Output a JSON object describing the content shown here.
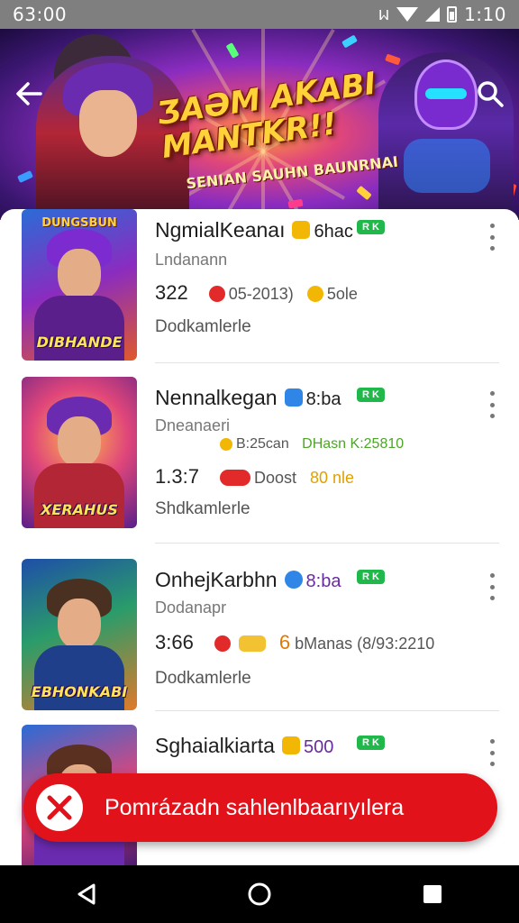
{
  "status_bar": {
    "time": "63:00",
    "right_time": "1:10",
    "right_glyph": "ᥕ"
  },
  "banner": {
    "title_line1": "ƷAƏM AKABI",
    "title_line2": "MANTKR!!",
    "subtitle": "SENIAN SAUHN BAUNRNAI"
  },
  "items": [
    {
      "thumb_top": "DUNGSBUN",
      "thumb_title": "DIBHANDE",
      "title": "NgmialKeanaı",
      "tag": "6hac",
      "tag_color": "#f2b705",
      "badge": "R K",
      "sub": "Lndanann",
      "number": "322",
      "meta1": "05-2013)",
      "meta2": "5ole",
      "foot": "Dodkamlerle"
    },
    {
      "thumb_top": "",
      "thumb_title": "XERAHUS",
      "title": "Nennalkegan",
      "tag": "8:ba",
      "tag_color": "#2f86e6",
      "badge": "R K",
      "sub": "Dneanaeri",
      "extra1": "B:25can",
      "extra2": "DHasn K:25810",
      "number": "1.3:7",
      "meta1": "Doost",
      "meta2": "80 nle",
      "foot": "Shdkamlerle"
    },
    {
      "thumb_top": "",
      "thumb_title": "EBHONKABI",
      "title": "OnhejKarbhn",
      "tag": "8:ba",
      "tag_color": "#2f86e6",
      "badge": "R K",
      "sub": "Dodanapr",
      "number": "3:66",
      "meta1": "6",
      "meta2": "bManas (8/93:2210",
      "foot": "Dodkamlerle"
    },
    {
      "thumb_top": "",
      "thumb_title": "",
      "title": "Sghaialkiarta",
      "tag": "500",
      "tag_color": "#f2b705",
      "badge": "R K",
      "sub": ""
    }
  ],
  "toast": {
    "message": "Pomrázadn sahlenlbaarıyılera"
  },
  "icons": {
    "back": "back-arrow-icon",
    "search": "search-icon",
    "more": "more-vertical-icon",
    "error": "error-x-icon",
    "nav_back": "nav-back-triangle-icon",
    "nav_home": "nav-home-circle-icon",
    "nav_recents": "nav-recents-square-icon"
  },
  "colors": {
    "badge": "#20b84a",
    "toast": "#e2121b",
    "navbar": "#000000"
  }
}
